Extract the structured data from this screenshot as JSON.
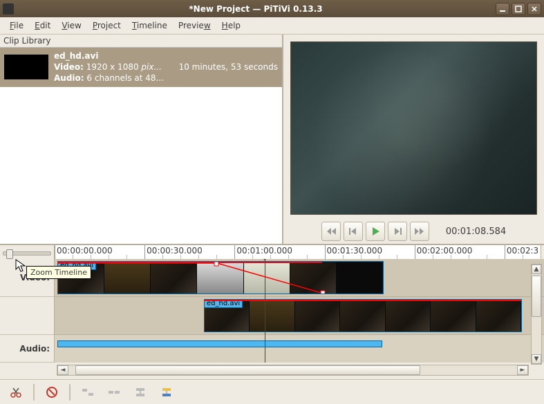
{
  "window": {
    "title": "*New Project — PiTiVi 0.13.3"
  },
  "menu": {
    "file": "File",
    "edit": "Edit",
    "view": "View",
    "project": "Project",
    "timeline": "Timeline",
    "preview": "Preview",
    "help": "Help"
  },
  "library": {
    "heading": "Clip Library",
    "clip": {
      "name": "ed_hd.avi",
      "video_line": "Video: 1920 x 1080 pix...",
      "audio_line": "Audio: 6 channels at 48...",
      "duration": "10 minutes, 53 seconds"
    }
  },
  "transport": {
    "timecode": "00:01:08.584"
  },
  "zoom": {
    "tooltip": "Zoom Timeline"
  },
  "ruler": {
    "ticks": [
      "00:00:00.000",
      "00:00:30.000",
      "00:01:00.000",
      "00:01:30.000",
      "00:02:00.000",
      "00:02:3"
    ]
  },
  "timeline": {
    "video_label": "Video:",
    "audio_label": "Audio:",
    "clip1": {
      "label": "ed_hd.avi"
    },
    "clip2": {
      "label": "ed_hd.avi"
    }
  },
  "colors": {
    "accent": "#58b4e8",
    "sel": "#a99b84"
  }
}
